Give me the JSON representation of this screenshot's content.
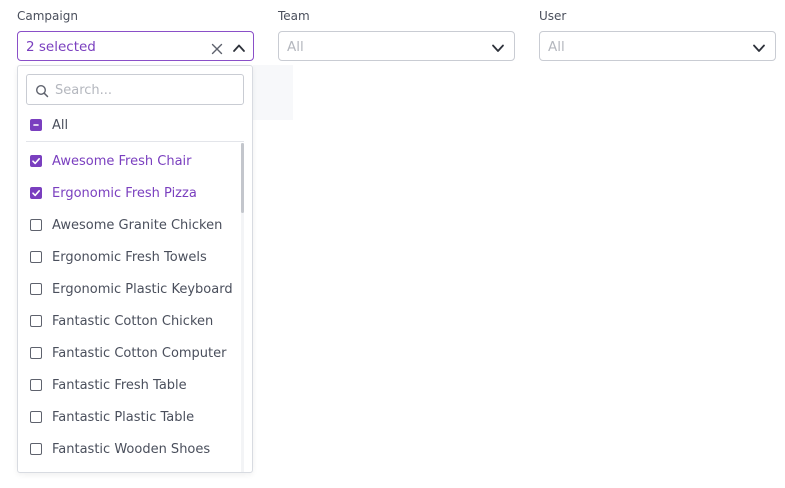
{
  "filters": {
    "campaign": {
      "label": "Campaign",
      "value": "2 selected"
    },
    "team": {
      "label": "Team",
      "placeholder": "All"
    },
    "user": {
      "label": "User",
      "placeholder": "All"
    }
  },
  "dropdown": {
    "search_placeholder": "Search...",
    "all_label": "All",
    "options": [
      {
        "label": "Awesome Fresh Chair",
        "checked": true
      },
      {
        "label": "Ergonomic Fresh Pizza",
        "checked": true
      },
      {
        "label": "Awesome Granite Chicken",
        "checked": false
      },
      {
        "label": "Ergonomic Fresh Towels",
        "checked": false
      },
      {
        "label": "Ergonomic Plastic Keyboard",
        "checked": false
      },
      {
        "label": "Fantastic Cotton Chicken",
        "checked": false
      },
      {
        "label": "Fantastic Cotton Computer",
        "checked": false
      },
      {
        "label": "Fantastic Fresh Table",
        "checked": false
      },
      {
        "label": "Fantastic Plastic Table",
        "checked": false
      },
      {
        "label": "Fantastic Wooden Shoes",
        "checked": false
      }
    ]
  },
  "icons": {
    "clear": "close-icon",
    "chevron_up": "chevron-up-icon",
    "chevron_down": "chevron-down-icon",
    "search": "search-icon",
    "check": "check-icon",
    "indeterminate": "minus-icon"
  },
  "colors": {
    "accent": "#7a3fbf",
    "border": "#c9ccd3",
    "text": "#4a4f5c",
    "placeholder": "#b4b7be"
  }
}
